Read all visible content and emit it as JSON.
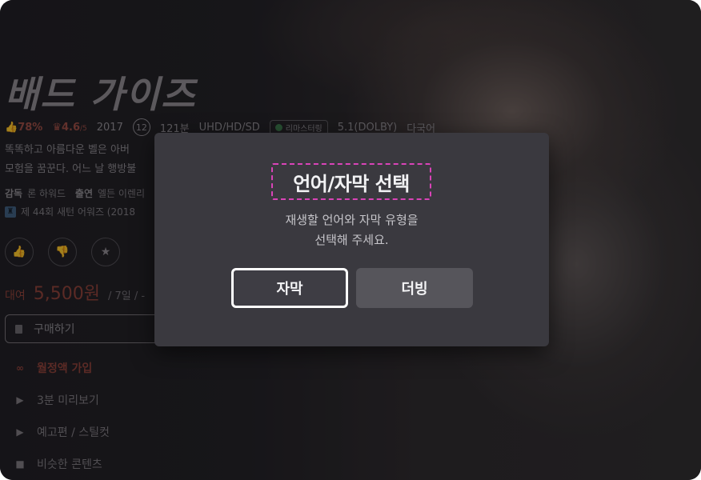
{
  "background": {
    "title": "배드 가이즈",
    "meta": {
      "like_percent": "78%",
      "score": "4.6",
      "score_suffix": "/5",
      "year": "2017",
      "age_rating": "12",
      "runtime": "121분",
      "quality": "UHD/HD/SD",
      "badge": "리마스터링",
      "audio": "5.1(DOLBY)",
      "language": "다국어"
    },
    "description_line1": "똑똑하고 아름다운 벨은 아버",
    "description_line2": "모험을 꿈꾼다. 어느 날 행방불",
    "credits": {
      "director_label": "감독",
      "director": "론 하워드",
      "cast_label": "출연",
      "cast": "엘든 이렌리"
    },
    "award": "제 44회 새턴 어워즈 (2018",
    "price": {
      "label": "대여",
      "amount": "5,500원",
      "period": "/ 7일 / -"
    },
    "buy_button": "구매하기",
    "menu": [
      {
        "icon": "infinity-icon",
        "glyph": "∞",
        "label": "월정액 가입"
      },
      {
        "icon": "play-icon",
        "glyph": "▶",
        "label": "3분 미리보기"
      },
      {
        "icon": "play-icon",
        "glyph": "▶",
        "label": "예고편 / 스틸컷"
      },
      {
        "icon": "grid-icon",
        "glyph": "■",
        "label": "비슷한 콘텐츠"
      }
    ]
  },
  "dialog": {
    "title": "언어/자막 선택",
    "message_line1": "재생할 언어와 자막 유형을",
    "message_line2": "선택해 주세요.",
    "primary_button": "자막",
    "secondary_button": "더빙"
  },
  "colors": {
    "accent_red": "#8d3e35",
    "focus_outline": "#d944b8",
    "dialog_bg": "#3a393f"
  }
}
